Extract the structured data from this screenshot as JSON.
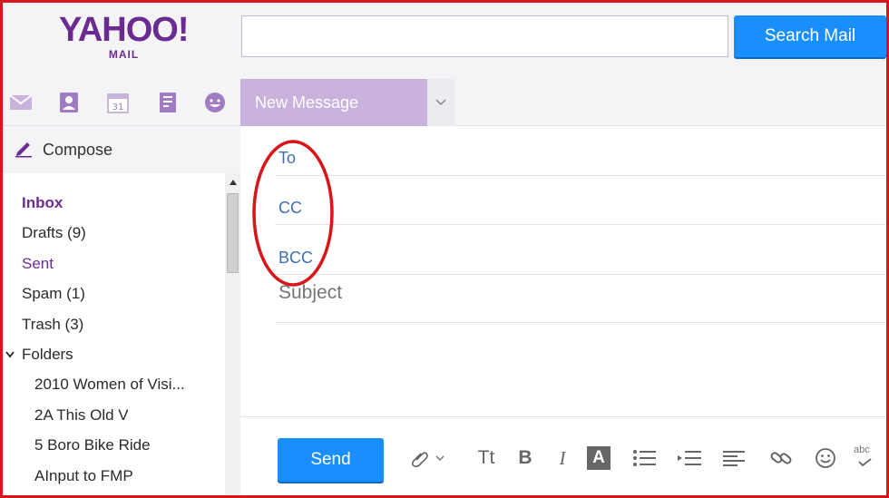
{
  "logo": {
    "main": "YAHOO!",
    "sub": "MAIL"
  },
  "search": {
    "placeholder": "",
    "button_label": "Search Mail"
  },
  "iconbar": {
    "icons": [
      "mail-icon",
      "contacts-icon",
      "calendar-icon",
      "notepad-icon",
      "messenger-icon"
    ],
    "calendar_day": "31"
  },
  "tab": {
    "label": "New Message"
  },
  "compose": {
    "label": "Compose"
  },
  "folders": {
    "inbox": "Inbox",
    "drafts": "Drafts (9)",
    "sent": "Sent",
    "spam": "Spam (1)",
    "trash": "Trash (3)",
    "folders_head": "Folders",
    "subfolders": [
      "2010 Women of Visi...",
      "2A This Old V",
      "5 Boro Bike Ride",
      "AInput to FMP"
    ]
  },
  "message": {
    "to_label": "To",
    "cc_label": "CC",
    "bcc_label": "BCC",
    "subject_placeholder": "Subject"
  },
  "toolbar": {
    "send_label": "Send",
    "font_size_label": "Tt",
    "bold_label": "B",
    "italic_label": "I",
    "color_label": "A",
    "spellcheck_label": "abc"
  },
  "colors": {
    "brand_purple": "#6b2c91",
    "tab_purple": "#c9b3dc",
    "primary_blue": "#198fff",
    "annotation_red": "#d9151c",
    "field_label_blue": "#3f6fb0"
  }
}
